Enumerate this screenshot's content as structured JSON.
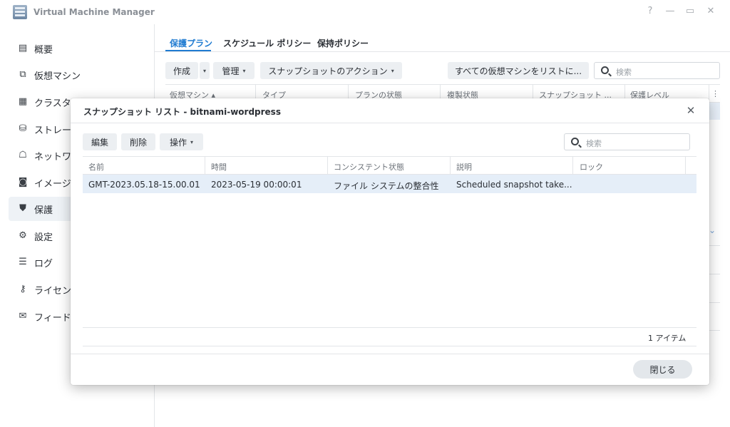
{
  "window": {
    "title": "Virtual Machine Manager",
    "help": "?",
    "minimize": "—",
    "maximize": "▭",
    "close": "✕"
  },
  "sidebar": {
    "items": [
      {
        "label": "概要",
        "icon": "overview-icon"
      },
      {
        "label": "仮想マシン",
        "icon": "virtual-machine-icon"
      },
      {
        "label": "クラスタ",
        "icon": "cluster-icon"
      },
      {
        "label": "ストレー",
        "icon": "storage-icon"
      },
      {
        "label": "ネットワ",
        "icon": "network-icon"
      },
      {
        "label": "イメージ",
        "icon": "image-icon"
      },
      {
        "label": "保護",
        "icon": "shield-icon",
        "active": true
      },
      {
        "label": "設定",
        "icon": "gear-icon"
      },
      {
        "label": "ログ",
        "icon": "log-icon"
      },
      {
        "label": "ライセン",
        "icon": "key-icon"
      },
      {
        "label": "フィード",
        "icon": "mail-icon"
      }
    ]
  },
  "main": {
    "tabs": [
      "保護プラン",
      "スケジュール ポリシー",
      "保持ポリシー"
    ],
    "toolbar": {
      "create": "作成",
      "manage": "管理",
      "snapshot_action": "スナップショットのアクション",
      "list_all": "すべての仮想マシンをリストに...",
      "search_placeholder": "検索"
    },
    "columns": [
      "仮想マシン ▴",
      "タイプ",
      "プランの状態",
      "複製状態",
      "スナップショット ...",
      "保護レベル"
    ]
  },
  "modal": {
    "title": "スナップショット リスト - bitnami-wordpress",
    "close": "✕",
    "toolbar": {
      "edit": "編集",
      "delete": "削除",
      "operation": "操作",
      "search_placeholder": "検索"
    },
    "columns": [
      "名前",
      "時間",
      "コンシステント状態",
      "説明",
      "ロック"
    ],
    "rows": [
      {
        "name": "GMT-2023.05.18-15.00.01",
        "time": "2023-05-19 00:00:01",
        "consistency": "ファイル システムの整合性",
        "description": "Scheduled snapshot take...",
        "lock": ""
      }
    ],
    "item_count": "1 アイテム",
    "close_button": "閉じる"
  }
}
